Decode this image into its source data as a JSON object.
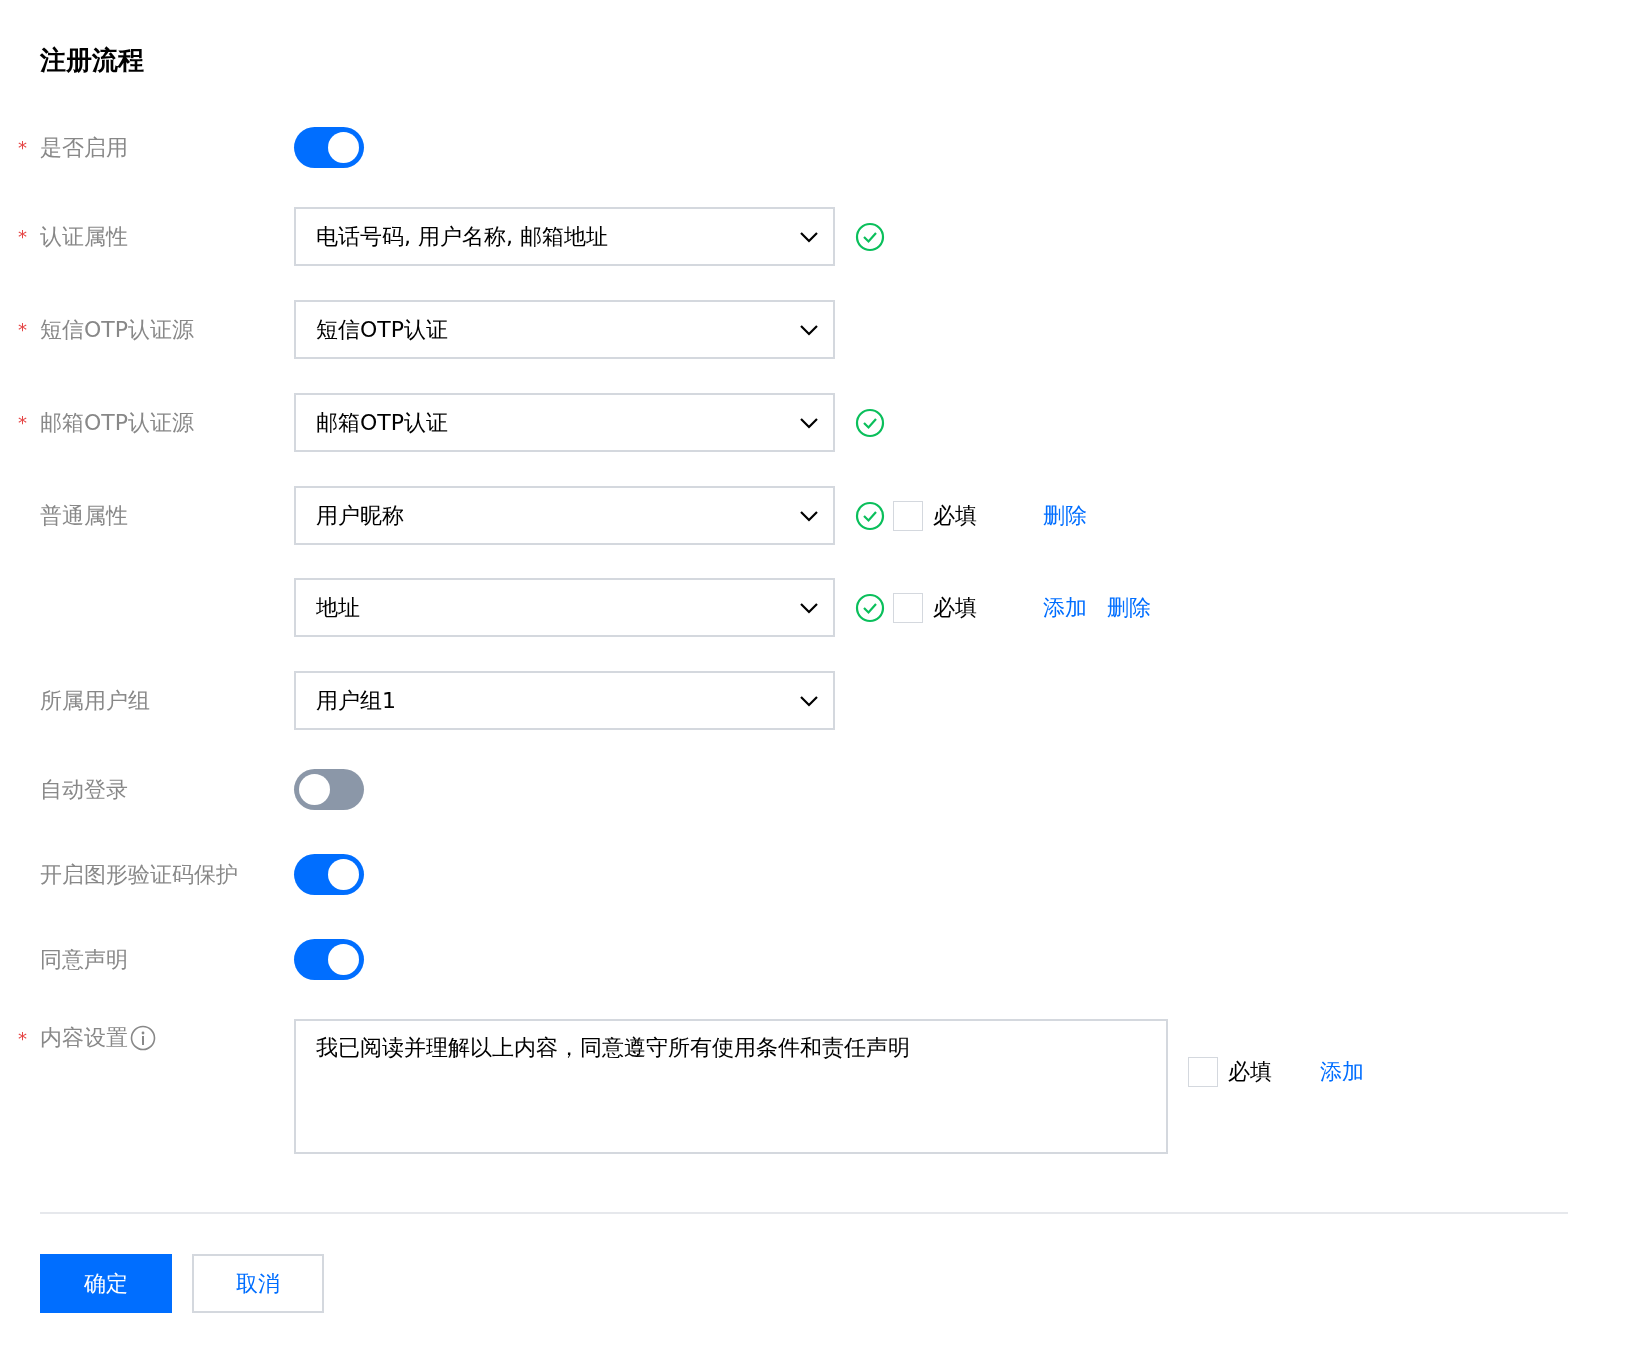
{
  "title": "注册流程",
  "fields": [
    {
      "kind": "toggle",
      "label": "是否启用",
      "required_mark": "*",
      "on": true
    },
    {
      "kind": "select",
      "label": "认证属性",
      "required_mark": "*",
      "value": "电话号码, 用户名称, 邮箱地址",
      "valid": true
    },
    {
      "kind": "select",
      "label": "短信OTP认证源",
      "required_mark": "*",
      "value": "短信OTP认证"
    },
    {
      "kind": "select",
      "label": "邮箱OTP认证源",
      "required_mark": "*",
      "value": "邮箱OTP认证",
      "valid": true
    },
    {
      "kind": "attributes",
      "label": "普通属性",
      "items": [
        {
          "value": "用户昵称",
          "valid": true,
          "checked": false,
          "check_label": "必填",
          "links": [
            "删除"
          ]
        },
        {
          "value": "地址",
          "valid": true,
          "checked": false,
          "check_label": "必填",
          "links": [
            "添加",
            "删除"
          ]
        }
      ]
    },
    {
      "kind": "select",
      "label": "所属用户组",
      "value": "用户组1"
    },
    {
      "kind": "toggle",
      "label": "自动登录",
      "on": false
    },
    {
      "kind": "toggle",
      "label": "开启图形验证码保护",
      "on": true
    },
    {
      "kind": "toggle",
      "label": "同意声明",
      "on": true
    },
    {
      "kind": "textarea",
      "label": "内容设置",
      "required_mark": "*",
      "info": true,
      "value": "我已阅读并理解以上内容，同意遵守所有使用条件和责任声明",
      "checked": false,
      "check_label": "必填",
      "links": [
        "添加"
      ]
    }
  ],
  "buttons": [
    {
      "label": "确定",
      "kind": "primary"
    },
    {
      "label": "取消",
      "kind": "secondary"
    }
  ]
}
